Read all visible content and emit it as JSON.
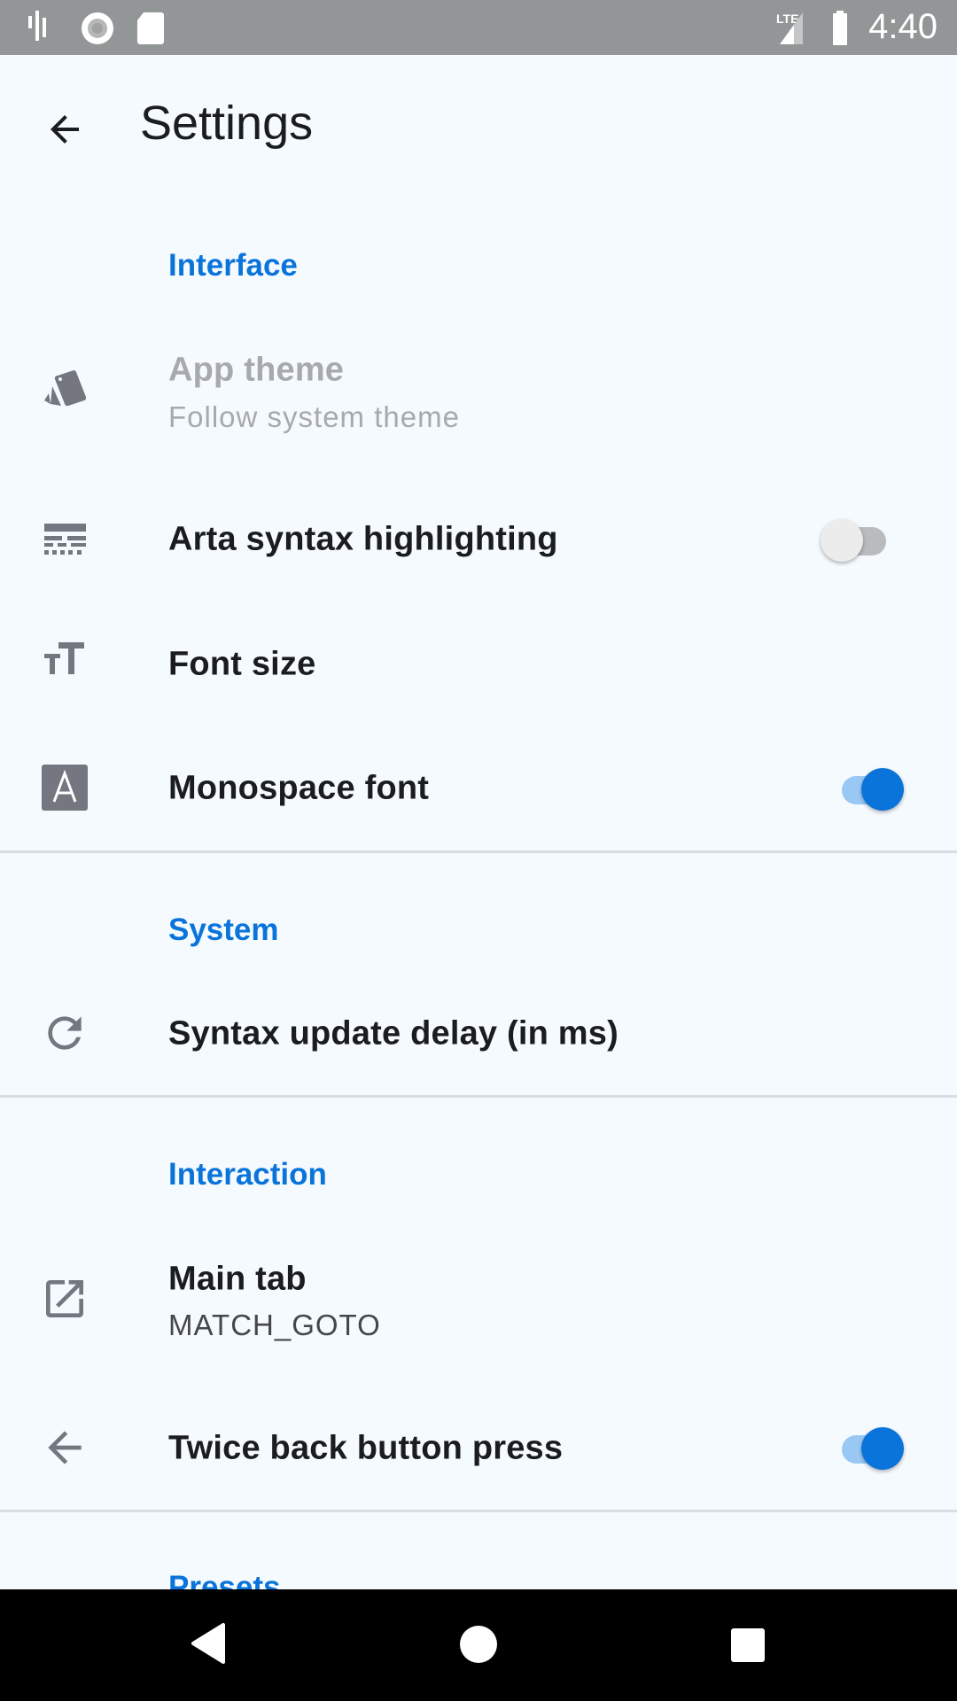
{
  "status_bar": {
    "time": "4:40",
    "network": "LTE",
    "icons": [
      "audio-wave-icon",
      "record-icon",
      "sd-card-icon",
      "signal-icon",
      "battery-icon"
    ]
  },
  "app_bar": {
    "title": "Settings",
    "back_icon": "arrow-back-icon"
  },
  "colors": {
    "accent": "#0a74da",
    "background": "#f5faff",
    "icon": "#74777f",
    "status_bar": "#939697"
  },
  "sections": [
    {
      "header": "Interface",
      "items": [
        {
          "title": "App theme",
          "summary": "Follow system theme",
          "icon": "palette-swatch-icon",
          "enabled": false
        },
        {
          "title": "Arta syntax highlighting",
          "icon": "text-lines-icon",
          "switch": false
        },
        {
          "title": "Font size",
          "icon": "format-size-icon"
        },
        {
          "title": "Monospace font",
          "icon": "font-a-icon",
          "switch": true
        }
      ]
    },
    {
      "header": "System",
      "items": [
        {
          "title": "Syntax update delay (in ms)",
          "icon": "refresh-icon"
        }
      ]
    },
    {
      "header": "Interaction",
      "items": [
        {
          "title": "Main tab",
          "summary": "MATCH_GOTO",
          "icon": "open-in-new-icon"
        },
        {
          "title": "Twice back button press",
          "icon": "arrow-back-icon",
          "switch": true
        }
      ]
    },
    {
      "header": "Presets",
      "items": []
    }
  ],
  "nav_bar": {
    "buttons": [
      "back",
      "home",
      "recents"
    ]
  }
}
